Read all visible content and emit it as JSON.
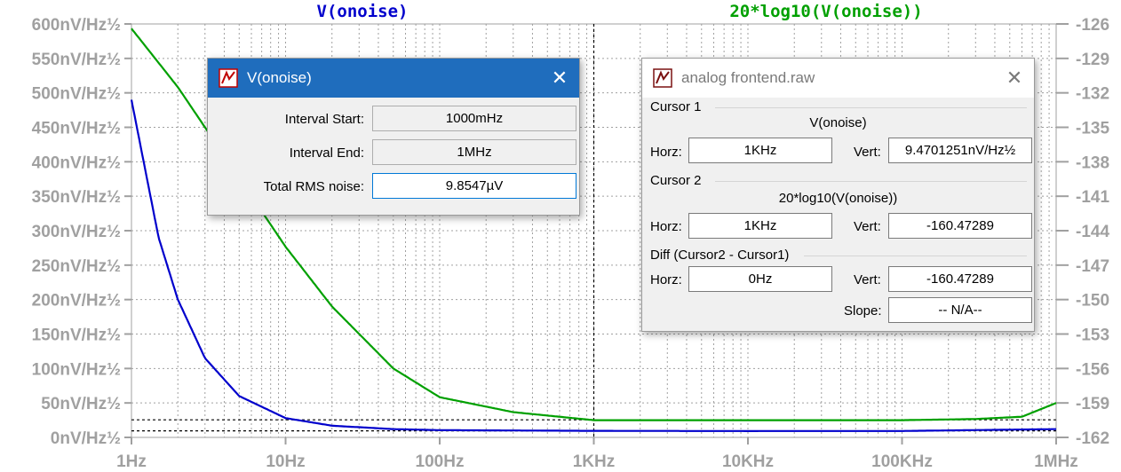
{
  "plot": {
    "left_trace_label": "V(onoise)",
    "right_trace_label": "20*log10(V(onoise))",
    "left_trace_color": "#0000cc",
    "right_trace_color": "#00a000",
    "background": "#ffffff",
    "grid_color": "#a0a0a0",
    "y_left_ticks": [
      "600nV/Hz½",
      "550nV/Hz½",
      "500nV/Hz½",
      "450nV/Hz½",
      "400nV/Hz½",
      "350nV/Hz½",
      "300nV/Hz½",
      "250nV/Hz½",
      "200nV/Hz½",
      "150nV/Hz½",
      "100nV/Hz½",
      "50nV/Hz½",
      "0nV/Hz½"
    ],
    "y_right_ticks": [
      "-126",
      "-129",
      "-132",
      "-135",
      "-138",
      "-141",
      "-144",
      "-147",
      "-150",
      "-153",
      "-156",
      "-159",
      "-162"
    ],
    "x_ticks": [
      "1Hz",
      "10Hz",
      "100Hz",
      "1KHz",
      "10KHz",
      "100KHz",
      "1MHz"
    ]
  },
  "chart_data": {
    "type": "line",
    "x_scale": "log",
    "xlim": [
      "1Hz",
      "1MHz"
    ],
    "ylim_left": [
      0,
      600
    ],
    "ylim_left_unit": "nV/Hz½",
    "ylim_right": [
      -162,
      -126
    ],
    "grid": true,
    "series": [
      {
        "name": "V(onoise)",
        "axis": "left",
        "color": "#0000cc",
        "x": [
          1,
          1.5,
          2,
          3,
          5,
          10,
          20,
          50,
          100,
          1000,
          10000,
          100000,
          1000000
        ],
        "y": [
          490,
          290,
          200,
          115,
          60,
          28,
          17,
          12,
          10.5,
          9.5,
          9.2,
          9.3,
          12
        ]
      },
      {
        "name": "20*log10(V(onoise))",
        "axis": "right",
        "color": "#00a000",
        "x": [
          1,
          2,
          3,
          5,
          10,
          20,
          50,
          100,
          300,
          1000,
          10000,
          100000,
          300000,
          600000,
          1000000
        ],
        "y": [
          -126.4,
          -131.5,
          -135.0,
          -139.4,
          -145.4,
          -150.6,
          -156.0,
          -158.5,
          -159.8,
          -160.5,
          -160.5,
          -160.5,
          -160.4,
          -160.2,
          -159.0
        ]
      }
    ],
    "cursor_lines": [
      {
        "orientation": "vertical",
        "x": 1000
      },
      {
        "orientation": "horizontal",
        "axis": "left",
        "y": 9.47
      },
      {
        "orientation": "horizontal",
        "axis": "right",
        "y": -160.47
      }
    ]
  },
  "win_noise": {
    "title": "V(onoise)",
    "close_label": "✕",
    "interval_start_label": "Interval Start:",
    "interval_start_value": "1000mHz",
    "interval_end_label": "Interval End:",
    "interval_end_value": "1MHz",
    "rms_label": "Total RMS noise:",
    "rms_value": "9.8547µV"
  },
  "win_cursor": {
    "title": "analog frontend.raw",
    "close_label": "✕",
    "cursor1_group": "Cursor 1",
    "cursor1_trace": "V(onoise)",
    "cursor1_horz_label": "Horz:",
    "cursor1_horz_value": "1KHz",
    "cursor1_vert_label": "Vert:",
    "cursor1_vert_value": "9.4701251nV/Hz½",
    "cursor2_group": "Cursor 2",
    "cursor2_trace": "20*log10(V(onoise))",
    "cursor2_horz_label": "Horz:",
    "cursor2_horz_value": "1KHz",
    "cursor2_vert_label": "Vert:",
    "cursor2_vert_value": "-160.47289",
    "diff_group": "Diff (Cursor2 - Cursor1)",
    "diff_horz_label": "Horz:",
    "diff_horz_value": "0Hz",
    "diff_vert_label": "Vert:",
    "diff_vert_value": "-160.47289",
    "slope_label": "Slope:",
    "slope_value": "-- N/A--"
  }
}
